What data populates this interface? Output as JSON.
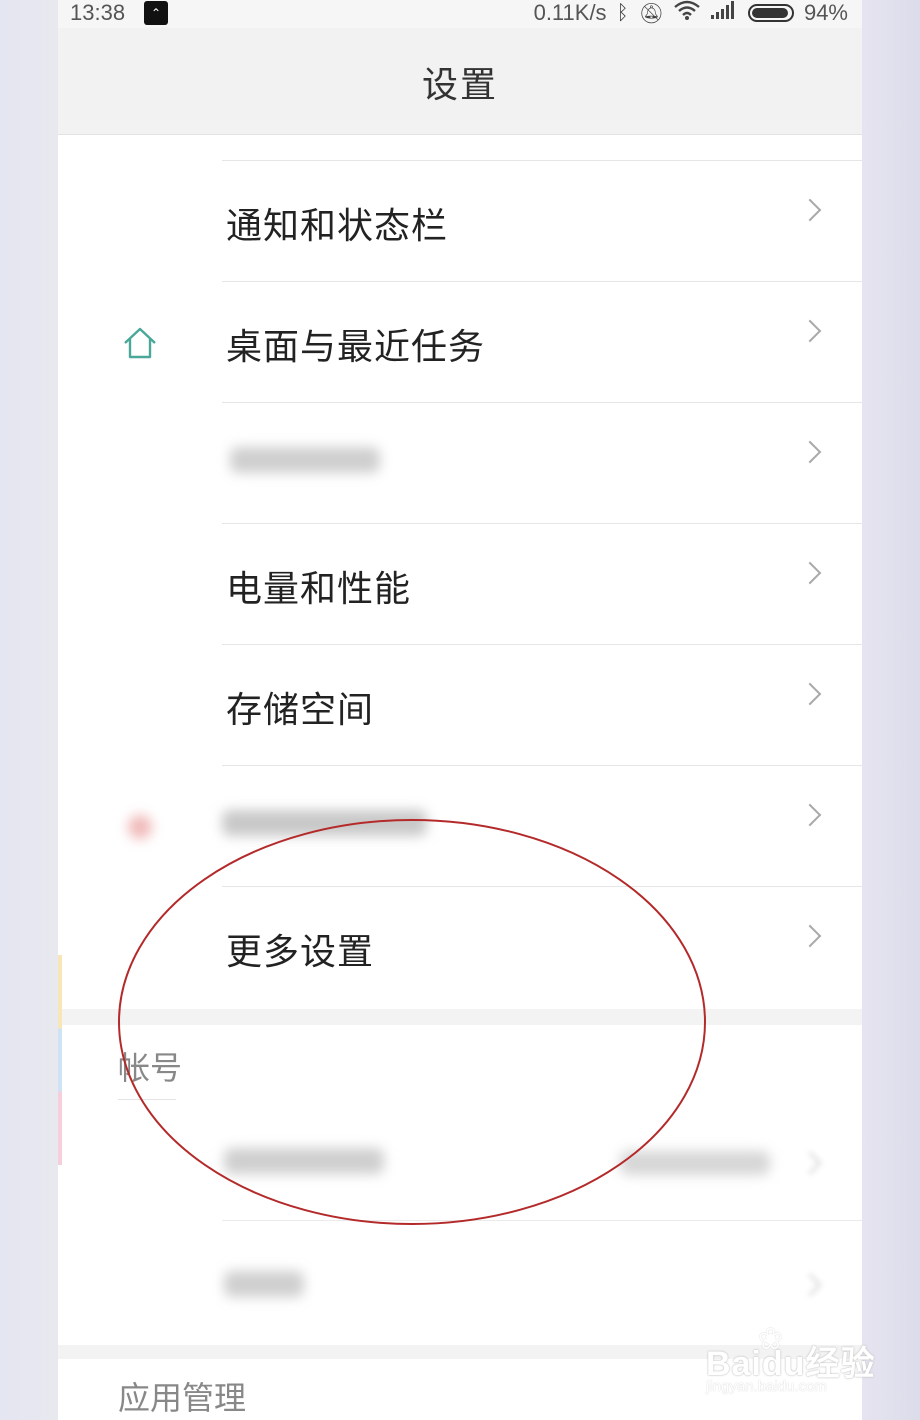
{
  "status_bar": {
    "time": "13:38",
    "network_speed": "0.11K/s",
    "battery_percent": "94%",
    "icons": [
      "app-notification-icon",
      "bluetooth-icon",
      "mute-icon",
      "wifi-icon",
      "signal-icon",
      "battery-icon"
    ]
  },
  "header": {
    "title": "设置"
  },
  "settings_items": [
    {
      "label": "通知和状态栏",
      "icon": ""
    },
    {
      "label": "桌面与最近任务",
      "icon": "home-icon"
    },
    {
      "label": "",
      "icon": "",
      "blurred": true
    },
    {
      "label": "电量和性能",
      "icon": ""
    },
    {
      "label": "存储空间",
      "icon": ""
    },
    {
      "label": "",
      "icon": "",
      "blurred": true
    },
    {
      "label": "更多设置",
      "icon": ""
    }
  ],
  "account_section": {
    "header": "帐号",
    "items": [
      {
        "label": "",
        "value": "",
        "blurred": true
      },
      {
        "label": "",
        "blurred": true
      }
    ]
  },
  "apps_section": {
    "header": "应用管理"
  },
  "watermark": {
    "logo": "Baidu经验",
    "url": "jingyan.baidu.com"
  },
  "colors": {
    "accent_icon": "#4aa89a",
    "annotation_ellipse": "#b42a2a",
    "title_bar": "#f2f2f2",
    "divider": "#e6e6e6"
  }
}
